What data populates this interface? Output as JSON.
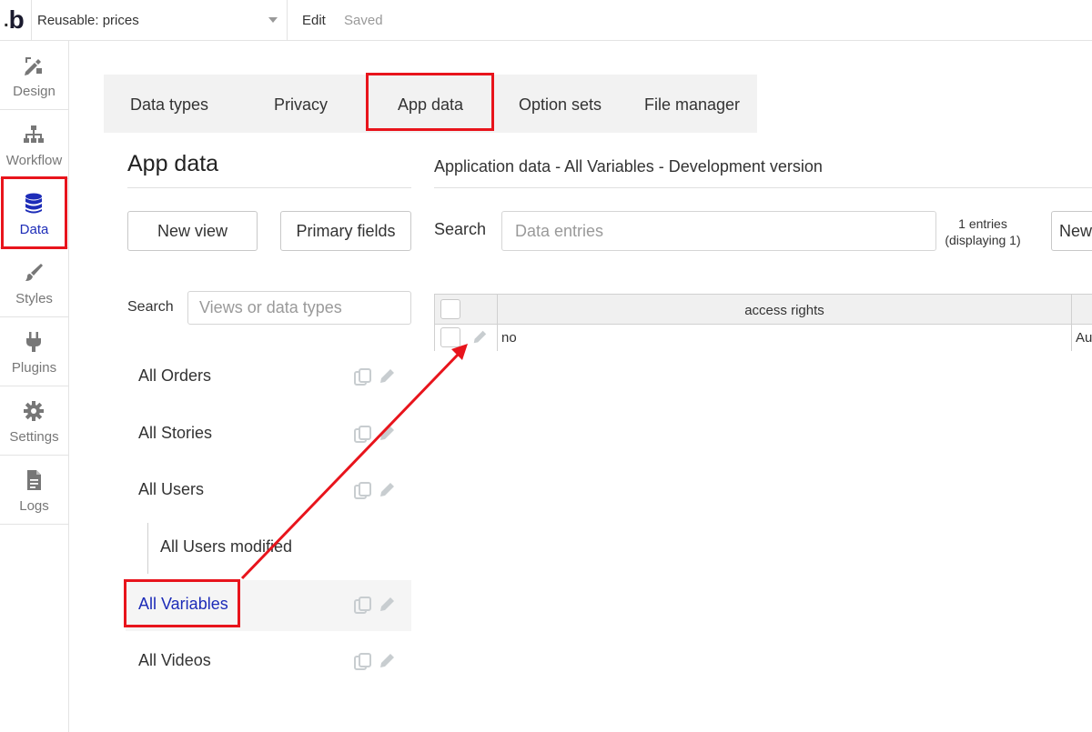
{
  "topbar": {
    "logo_letter": "b",
    "page_name": "Reusable: prices",
    "edit_label": "Edit",
    "saved_label": "Saved"
  },
  "leftnav": {
    "items": [
      {
        "label": "Design",
        "icon": "design-icon"
      },
      {
        "label": "Workflow",
        "icon": "workflow-icon"
      },
      {
        "label": "Data",
        "icon": "database-icon",
        "active": true
      },
      {
        "label": "Styles",
        "icon": "brush-icon"
      },
      {
        "label": "Plugins",
        "icon": "plug-icon"
      },
      {
        "label": "Settings",
        "icon": "gear-icon"
      },
      {
        "label": "Logs",
        "icon": "document-icon"
      }
    ]
  },
  "tabs": {
    "items": [
      {
        "label": "Data types"
      },
      {
        "label": "Privacy"
      },
      {
        "label": "App data",
        "active": true
      },
      {
        "label": "Option sets"
      },
      {
        "label": "File manager"
      }
    ]
  },
  "left_panel": {
    "title": "App data",
    "new_view_label": "New view",
    "primary_fields_label": "Primary fields",
    "search_label": "Search",
    "search_placeholder": "Views or data types",
    "views": [
      {
        "label": "All Orders"
      },
      {
        "label": "All Stories"
      },
      {
        "label": "All Users"
      },
      {
        "label": "All Users modified"
      },
      {
        "label": "All Variables",
        "selected": true
      },
      {
        "label": "All Videos"
      }
    ]
  },
  "data_panel": {
    "title": "Application data - All Variables - Development version",
    "search_label": "Search",
    "search_placeholder": "Data entries",
    "entries_count": "1 entries",
    "entries_displaying": "(displaying 1)",
    "new_entry_label": "New",
    "columns": [
      "access rights"
    ],
    "rows": [
      {
        "access_rights": "no",
        "next_col_partial": "Au"
      }
    ]
  },
  "colors": {
    "accent_blue": "#1d2cb8",
    "highlight_red": "#e8141c",
    "tab_bar_bg": "#f2f2f2"
  }
}
